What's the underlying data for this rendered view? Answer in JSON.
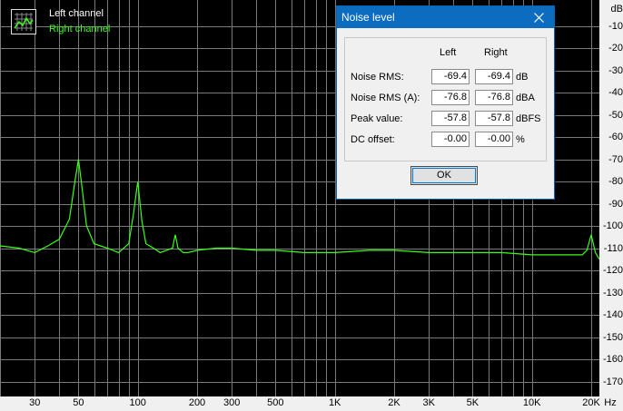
{
  "legend": {
    "left_channel": "Left channel",
    "right_channel": "Right channel",
    "left_color": "#ffffff",
    "right_color": "#39ff14"
  },
  "y_axis": {
    "unit": "dB",
    "ticks": [
      "-10",
      "-20",
      "-30",
      "-40",
      "-50",
      "-60",
      "-70",
      "-80",
      "-90",
      "-100",
      "-110",
      "-120",
      "-130",
      "-140",
      "-150",
      "-160",
      "-170"
    ]
  },
  "x_axis": {
    "unit": "Hz",
    "ticks": [
      "30",
      "50",
      "100",
      "200",
      "300",
      "500",
      "1K",
      "2K",
      "3K",
      "5K",
      "10K",
      "20K"
    ]
  },
  "dialog": {
    "title": "Noise level",
    "col_left": "Left",
    "col_right": "Right",
    "rows": [
      {
        "label": "Noise RMS:",
        "left": "-69.4",
        "right": "-69.4",
        "unit": "dB"
      },
      {
        "label": "Noise RMS (A):",
        "left": "-76.8",
        "right": "-76.8",
        "unit": "dBA"
      },
      {
        "label": "Peak value:",
        "left": "-57.8",
        "right": "-57.8",
        "unit": "dBFS"
      },
      {
        "label": "DC offset:",
        "left": "-0.00",
        "right": "-0.00",
        "unit": "%"
      }
    ],
    "ok_label": "OK"
  },
  "chart_data": {
    "type": "line",
    "xscale": "log",
    "xlim": [
      20,
      22000
    ],
    "ylim": [
      -180,
      0
    ],
    "grid": true,
    "series": [
      {
        "name": "Right channel",
        "color": "#39ff14",
        "x": [
          20,
          25,
          30,
          35,
          40,
          45,
          48,
          50,
          52,
          55,
          60,
          70,
          80,
          90,
          95,
          100,
          105,
          110,
          120,
          130,
          140,
          150,
          155,
          160,
          170,
          180,
          200,
          250,
          300,
          400,
          500,
          700,
          1000,
          1500,
          2000,
          3000,
          5000,
          7000,
          10000,
          15000,
          18000,
          19000,
          20000,
          21000,
          22000
        ],
        "y": [
          -109,
          -110,
          -112,
          -109,
          -106,
          -97,
          -80,
          -70,
          -82,
          -100,
          -108,
          -110,
          -112,
          -108,
          -95,
          -80,
          -98,
          -108,
          -110,
          -112,
          -111,
          -110,
          -104,
          -110,
          -112,
          -112,
          -111,
          -110,
          -110,
          -111,
          -111,
          -112,
          -112,
          -111,
          -111,
          -112,
          -112,
          -112,
          -113,
          -113,
          -113,
          -111,
          -104,
          -112,
          -115
        ]
      }
    ]
  }
}
